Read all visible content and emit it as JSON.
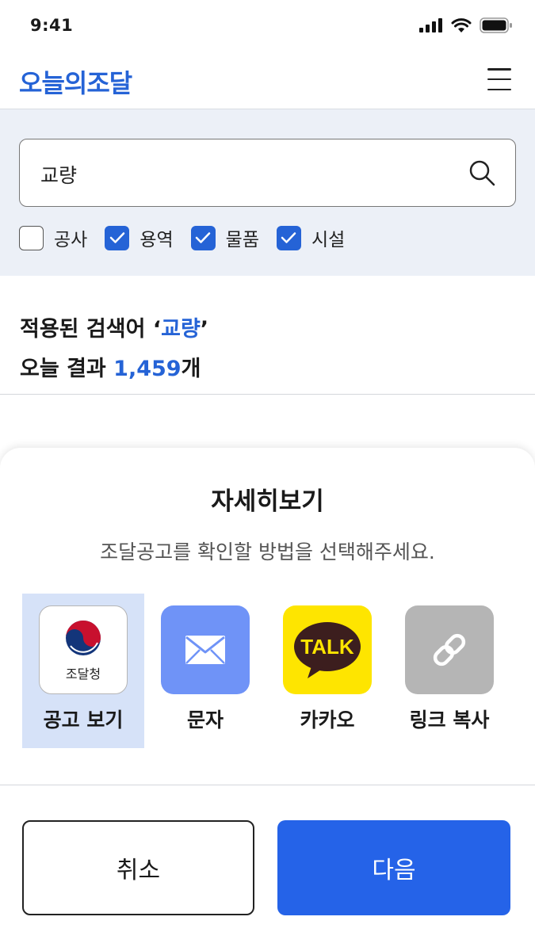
{
  "status_bar": {
    "time": "9:41"
  },
  "header": {
    "logo": "오늘의조달",
    "menu_icon": "hamburger-menu-icon"
  },
  "search": {
    "value": "교량",
    "icon": "search-icon",
    "filters": [
      {
        "label": "공사",
        "checked": false
      },
      {
        "label": "용역",
        "checked": true
      },
      {
        "label": "물품",
        "checked": true
      },
      {
        "label": "시설",
        "checked": true
      }
    ]
  },
  "results": {
    "line1_prefix": "적용된 검색어 ‘",
    "keyword": "교량",
    "line1_suffix": "’",
    "line2_prefix": "오늘 결과 ",
    "count": "1,459",
    "line2_suffix": "개"
  },
  "sheet": {
    "title": "자세히보기",
    "subtitle": "조달공고를 확인할 방법을 선택해주세요.",
    "options": [
      {
        "label": "공고 보기",
        "tile_text": "조달청",
        "icon": "gov-emblem-icon",
        "selected": true
      },
      {
        "label": "문자",
        "icon": "envelope-icon",
        "selected": false
      },
      {
        "label": "카카오",
        "tile_text": "TALK",
        "icon": "kakaotalk-icon",
        "selected": false
      },
      {
        "label": "링크 복사",
        "icon": "link-icon",
        "selected": false
      }
    ],
    "cancel_label": "취소",
    "next_label": "다음"
  },
  "colors": {
    "accent": "#2563d6",
    "search_bg": "#ecf0f7",
    "kakao_yellow": "#fee500",
    "message_blue": "#6f93f7",
    "link_gray": "#b5b5b5",
    "next_button": "#2563e8"
  }
}
